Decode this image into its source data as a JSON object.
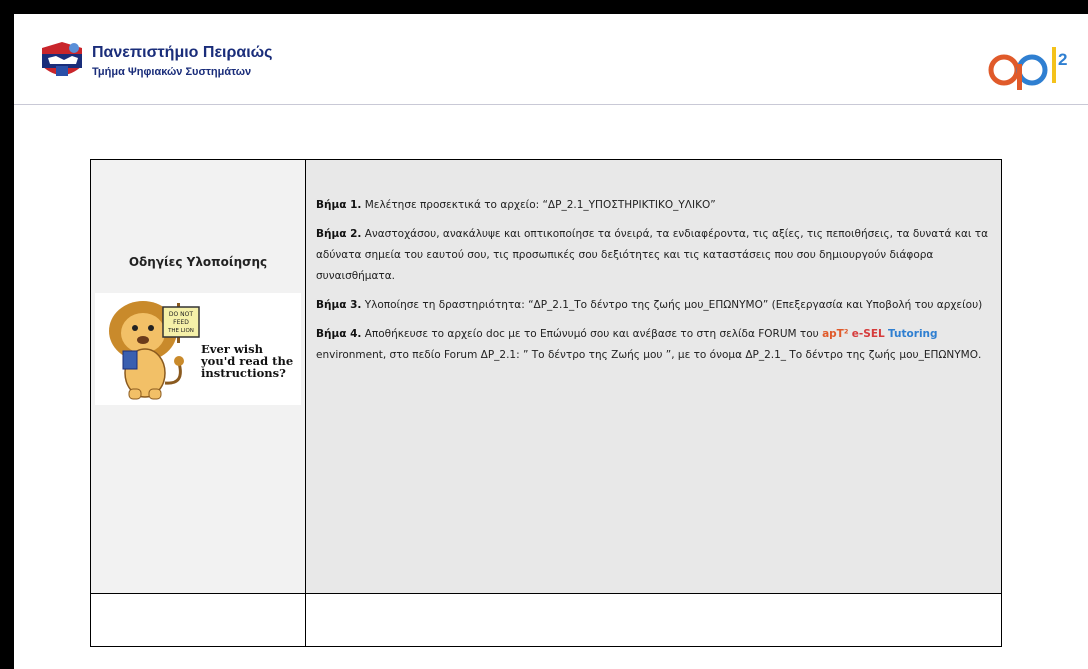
{
  "header": {
    "university_name": "Πανεπιστήμιο Πειραιώς",
    "department": "Τμήμα Ψηφιακών Συστημάτων",
    "apt_logo_text": "ap",
    "apt_logo_superscript": "2"
  },
  "table": {
    "left_title": "Οδηγίες Υλοποίησης",
    "image": {
      "sign_text": "DO NOT FEED THE LION",
      "caption": "Ever wish you'd read the instructions?"
    },
    "steps": [
      {
        "label": "Βήμα 1.",
        "text": " Μελέτησε προσεκτικά το αρχείο: “ΔΡ_2.1_ΥΠΟΣΤΗΡΙΚΤΙΚΟ_ΥΛΙΚΟ”"
      },
      {
        "label": "Βήμα 2.",
        "text": " Αναστοχάσου, ανακάλυψε και οπτικοποίησε τα όνειρά, τα ενδιαφέροντα, τις αξίες, τις πεποιθήσεις, τα δυνατά και τα αδύνατα σημεία του εαυτού σου, τις προσωπικές σου δεξιότητες και τις καταστάσεις που σου δημιουργούν διάφορα συναισθήματα."
      },
      {
        "label": "Βήμα 3.",
        "text": " Υλοποίησε τη δραστηριότητα: “ΔΡ_2.1_Το δέντρο της ζωής μου_ΕΠΩΝΥΜΟ” (Επεξεργασία και Υποβολή του αρχείου)"
      },
      {
        "label": "Βήμα 4.",
        "text_before": " Αποθήκευσε το αρχείο doc με το Επώνυμό σου και ανέβασε το στη σελίδα FORUM του ",
        "brand_apt": "apT²",
        "brand_esel": "e-SEL",
        "brand_tutoring": "Tutoring",
        "text_after": " environment,  στο πεδίο Forum ΔΡ_2.1: ” Το δέντρο της Ζωής μου ”, με το όνομα ΔΡ_2.1_ Το δέντρο της ζωής μου_ΕΠΩΝΥΜΟ."
      }
    ]
  },
  "colors": {
    "university_blue": "#1a2d7a",
    "apt_orange": "#e05a2a",
    "apt_blue": "#2f7fd1",
    "apt_yellow": "#f4c21b",
    "table_fill": "#e8e8e8"
  }
}
